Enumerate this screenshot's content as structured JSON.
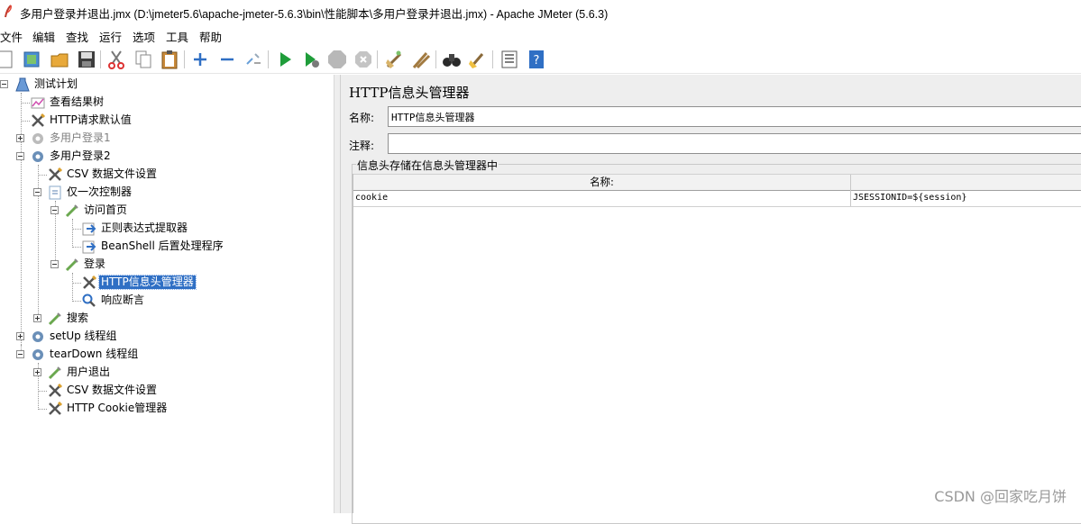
{
  "window": {
    "title": "多用户登录并退出.jmx (D:\\jmeter5.6\\apache-jmeter-5.6.3\\bin\\性能脚本\\多用户登录并退出.jmx) - Apache JMeter (5.6.3)"
  },
  "menu": [
    "文件",
    "编辑",
    "查找",
    "运行",
    "选项",
    "工具",
    "帮助"
  ],
  "toolbar": {
    "icons": [
      "new-icon",
      "templates-icon",
      "open-icon",
      "save-icon",
      "cut-icon",
      "copy-icon",
      "paste-icon",
      "expand-icon",
      "collapse-icon",
      "toggle-icon",
      "start-icon",
      "start-no-pause-icon",
      "stop-icon",
      "shutdown-icon",
      "clear-icon",
      "clear-all-icon",
      "search-icon",
      "reset-search-icon",
      "function-helper-icon",
      "help-icon"
    ]
  },
  "tree": {
    "items": [
      {
        "label": "测试计划",
        "icon": "test-plan-icon"
      },
      {
        "label": "查看结果树",
        "icon": "listener-icon"
      },
      {
        "label": "HTTP请求默认值",
        "icon": "config-icon"
      },
      {
        "label": "多用户登录1",
        "icon": "thread-group-icon",
        "disabled": true
      },
      {
        "label": "多用户登录2",
        "icon": "thread-group-icon"
      },
      {
        "label": "CSV 数据文件设置",
        "icon": "config-icon"
      },
      {
        "label": "仅一次控制器",
        "icon": "controller-icon"
      },
      {
        "label": "访问首页",
        "icon": "sampler-icon"
      },
      {
        "label": "正则表达式提取器",
        "icon": "post-processor-icon"
      },
      {
        "label": "BeanShell 后置处理程序",
        "icon": "post-processor-icon"
      },
      {
        "label": "登录",
        "icon": "sampler-icon"
      },
      {
        "label": "HTTP信息头管理器",
        "icon": "config-icon",
        "selected": true
      },
      {
        "label": "响应断言",
        "icon": "assertion-icon"
      },
      {
        "label": "搜索",
        "icon": "sampler-icon"
      },
      {
        "label": "setUp 线程组",
        "icon": "thread-group-icon"
      },
      {
        "label": "tearDown 线程组",
        "icon": "thread-group-icon"
      },
      {
        "label": "用户退出",
        "icon": "sampler-icon"
      },
      {
        "label": "CSV 数据文件设置",
        "icon": "config-icon"
      },
      {
        "label": "HTTP Cookie管理器",
        "icon": "config-icon"
      }
    ]
  },
  "panel": {
    "title": "HTTP信息头管理器",
    "name_label": "名称:",
    "name_value": "HTTP信息头管理器",
    "comment_label": "注释:",
    "comment_value": "",
    "group_title": "信息头存储在信息头管理器中",
    "table": {
      "headers": [
        "名称:",
        ""
      ],
      "rows": [
        {
          "name": "cookie",
          "value": "JSESSIONID=${session}"
        }
      ]
    }
  },
  "watermark": "CSDN @回家吃月饼"
}
